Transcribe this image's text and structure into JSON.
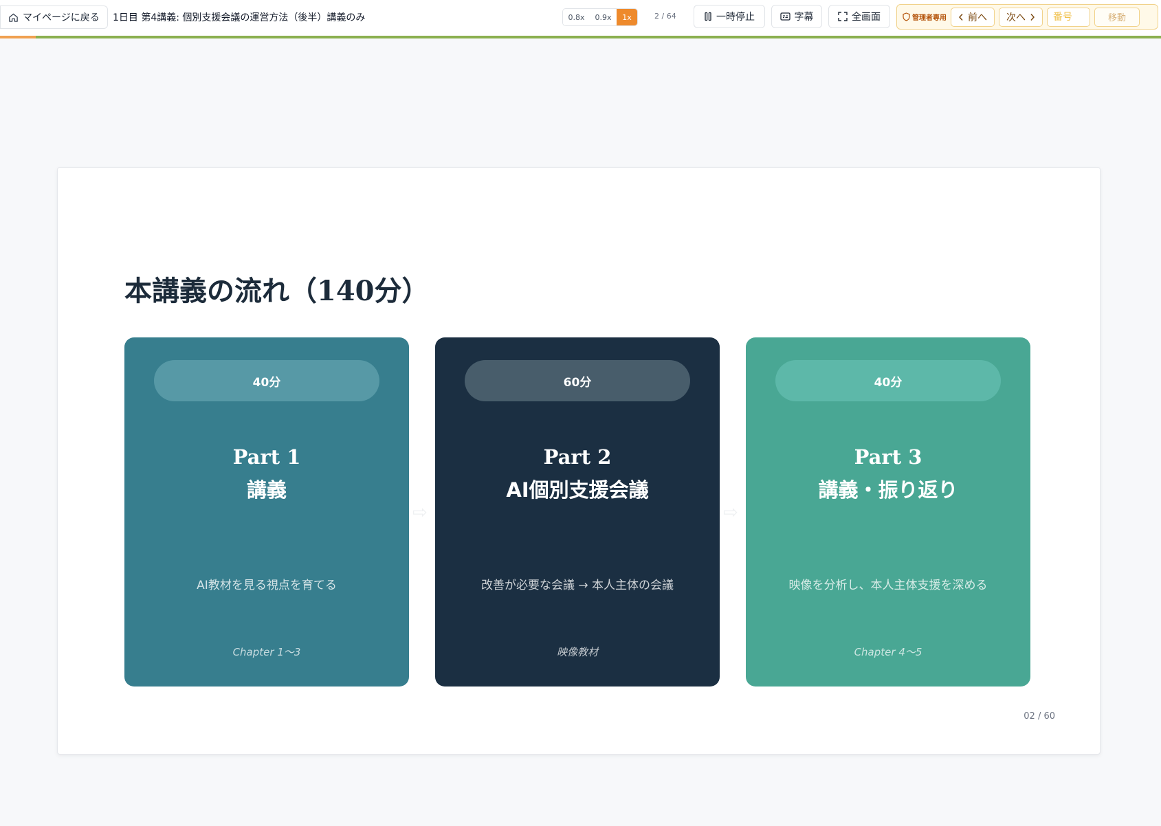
{
  "topbar": {
    "back_label": "マイページに戻る",
    "course_title": "1日目 第4講義: 個別支援会議の運営方法（後半）講義のみ",
    "speed_options": [
      "0.8x",
      "0.9x",
      "1x"
    ],
    "speed_active": "1x",
    "page_counter": "2 / 64",
    "progress_fraction": 0.031,
    "pause_label": "一時停止",
    "caption_label": "字幕",
    "fullscreen_label": "全画面",
    "admin": {
      "label": "管理者専用",
      "prev_label": "前へ",
      "next_label": "次へ",
      "page_placeholder": "番号",
      "move_label": "移動"
    }
  },
  "slide": {
    "title": "本講義の流れ（140分）",
    "cards": [
      {
        "duration": "40分",
        "part": "Part 1",
        "name": "講義",
        "description": "AI教材を見る視点を育てる",
        "chapter": "Chapter 1〜3"
      },
      {
        "duration": "60分",
        "part": "Part 2",
        "name": "AI個別支援会議",
        "description": "改善が必要な会議 → 本人主体の会議",
        "chapter": "映像教材"
      },
      {
        "duration": "40分",
        "part": "Part 3",
        "name": "講義・振り返り",
        "description": "映像を分析し、本人主体支援を深める",
        "chapter": "Chapter 4〜5"
      }
    ],
    "slide_number": "02 / 60"
  },
  "colors": {
    "card_1": "#377e8e",
    "card_2": "#1b2f42",
    "card_3": "#49a794",
    "accent_orange": "#ee8a2c",
    "progress_green": "#8bb04f"
  }
}
